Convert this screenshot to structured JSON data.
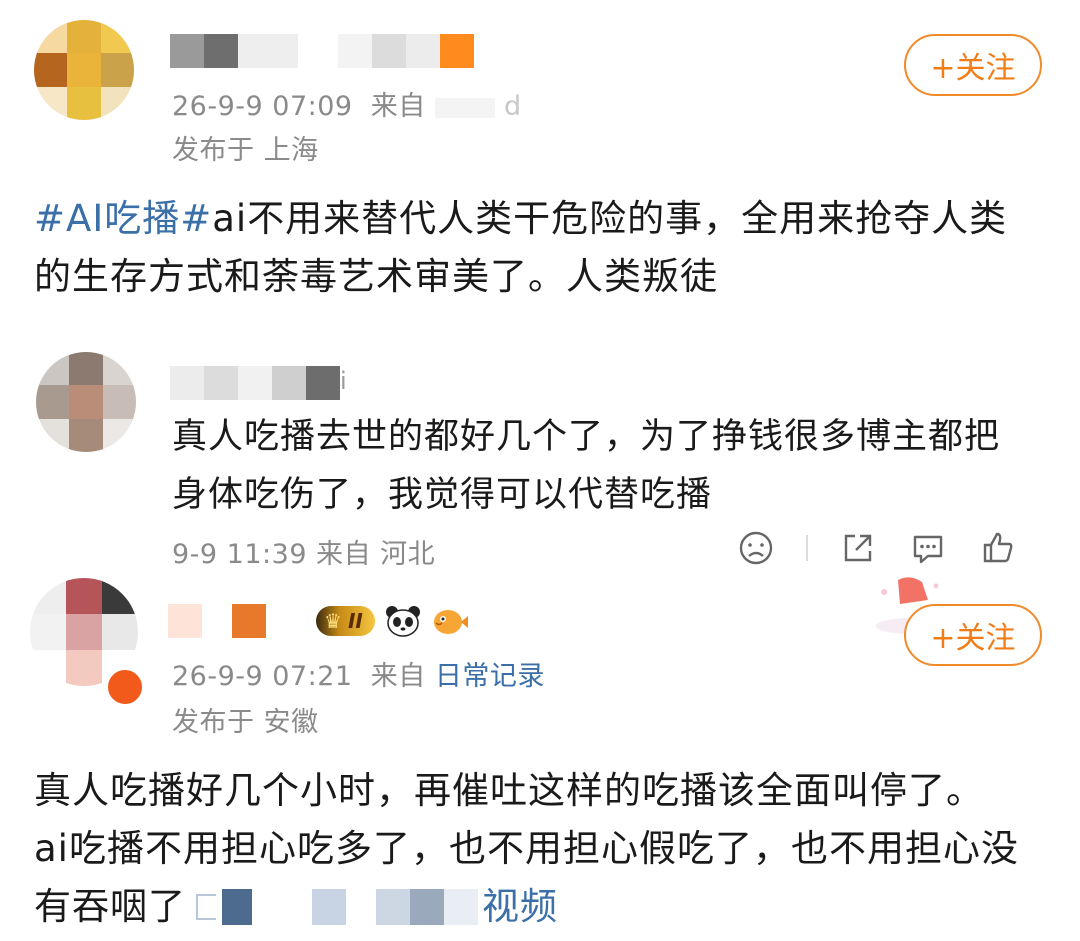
{
  "post1": {
    "time": "26-9-9 07:09",
    "source_prefix": "来自",
    "source_tail": "d",
    "location": "发布于 上海",
    "follow_label": "+关注",
    "topic": "#AI吃播#",
    "text_line1": "ai不用来替代人类干危险的事，全用来抢夺人类",
    "text_line2": "的生存方式和荼毒艺术审美了。人类叛徒"
  },
  "reply1": {
    "name_tail": "i",
    "text_line1": "真人吃播去世的都好几个了，为了挣钱很多博主都把",
    "text_line2": "身体吃伤了，我觉得可以代替吃播",
    "meta": "9-9 11:39 来自 河北"
  },
  "post2": {
    "time": "26-9-9 07:21",
    "source_prefix": "来自",
    "source_link": "日常记录",
    "location": "发布于 安徽",
    "follow_label": "+关注",
    "badge_level": "II",
    "text_line1": "真人吃播好几个小时，再催吐这样的吃播该全面叫停了。",
    "text_line2": "ai吃播不用担心吃多了，也不用担心假吃了，也不用担心没",
    "text_line3_start": "有吞咽了",
    "text_line3_end": "视频"
  },
  "colors": {
    "accent": "#f07d18",
    "link": "#3b6fa8",
    "meta": "#8a8a8a"
  },
  "icons": [
    "sad-face-icon",
    "share-icon",
    "comment-icon",
    "like-icon",
    "panda-icon",
    "pufferfish-icon",
    "crown-badge-icon"
  ]
}
